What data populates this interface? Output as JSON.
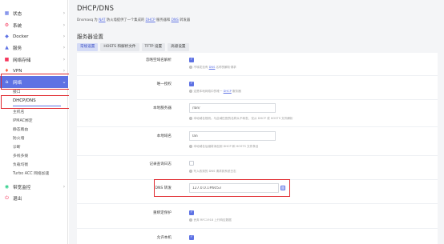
{
  "sidebar": {
    "items": [
      {
        "icon": "dashboard-icon",
        "glyph": "▦",
        "label": "状态",
        "color": "#5e72e4"
      },
      {
        "icon": "settings-icon",
        "glyph": "⚙",
        "label": "系统",
        "color": "#f5365c"
      },
      {
        "icon": "docker-icon",
        "glyph": "◆",
        "label": "Docker",
        "color": "#5e72e4"
      },
      {
        "icon": "services-icon",
        "glyph": "▲",
        "label": "服务",
        "color": "#5e72e4"
      },
      {
        "icon": "storage-icon",
        "glyph": "■",
        "label": "网络存储",
        "color": "#f5365c"
      },
      {
        "icon": "vpn-icon",
        "glyph": "♦",
        "label": "VPN",
        "color": "#fb6340"
      },
      {
        "icon": "network-icon",
        "glyph": "⌂",
        "label": "网络",
        "color": "#ffffff"
      },
      {
        "icon": "bandwidth-icon",
        "glyph": "◉",
        "label": "带宽监控",
        "color": "#2dce89"
      },
      {
        "icon": "logout-icon",
        "glyph": "⏻",
        "label": "退出",
        "color": "#f5365c"
      }
    ],
    "sub_items": [
      "接口",
      "DHCP/DNS",
      "主机名",
      "IPMAC绑定",
      "静态路由",
      "防火墙",
      "诊断",
      "多线多拨",
      "负载均衡",
      "Turbo ACC 网络加速"
    ],
    "chevron": "›",
    "chevron_open": "⌄"
  },
  "main": {
    "title": "DHCP/DNS",
    "desc_prefix": "Dnsmasq 为 ",
    "desc_link1": "NAT",
    "desc_mid": " 防火墙提供了一个集成的 ",
    "desc_link2": "DHCP",
    "desc_mid2": " 服务器和 ",
    "desc_link3": "DNS",
    "desc_suffix": " 转发器",
    "section_title": "服务器设置",
    "tabs": [
      "常规设置",
      "HOSTS 和解析文件",
      "TFTP 设置",
      "高级设置"
    ]
  },
  "form": {
    "domain_required": {
      "label": "忽略空域名解析",
      "hint_prefix": "不转发没有 ",
      "hint_link": "DNS",
      "hint_suffix": " 名称的解析请求"
    },
    "authoritative": {
      "label": "唯一授权",
      "hint_prefix": "这是本地网络中的唯一 ",
      "hint_link": "DHCP",
      "hint_suffix": " 服务器"
    },
    "local_server": {
      "label": "本地服务器",
      "value": "/lan/",
      "hint": "本地域名规则。与此域匹配的名称从不转发，仅从 DHCP 或 HOSTS 文件解析"
    },
    "local_domain": {
      "label": "本地域名",
      "value": "lan",
      "hint": "本地域名后缀将添加到 DHCP 和 HOSTS 文件条目"
    },
    "log_queries": {
      "label": "记录查询日志",
      "hint": "写入收到的 DNS 请求到系统日志"
    },
    "dns_forward": {
      "label": "DNS 转发",
      "value": "127.0.0.1#6053"
    },
    "rebind_protection": {
      "label": "重绑定保护",
      "hint": "丢弃 RFC1918 上行响应数据"
    },
    "localhost": {
      "label": "允许本机"
    }
  }
}
